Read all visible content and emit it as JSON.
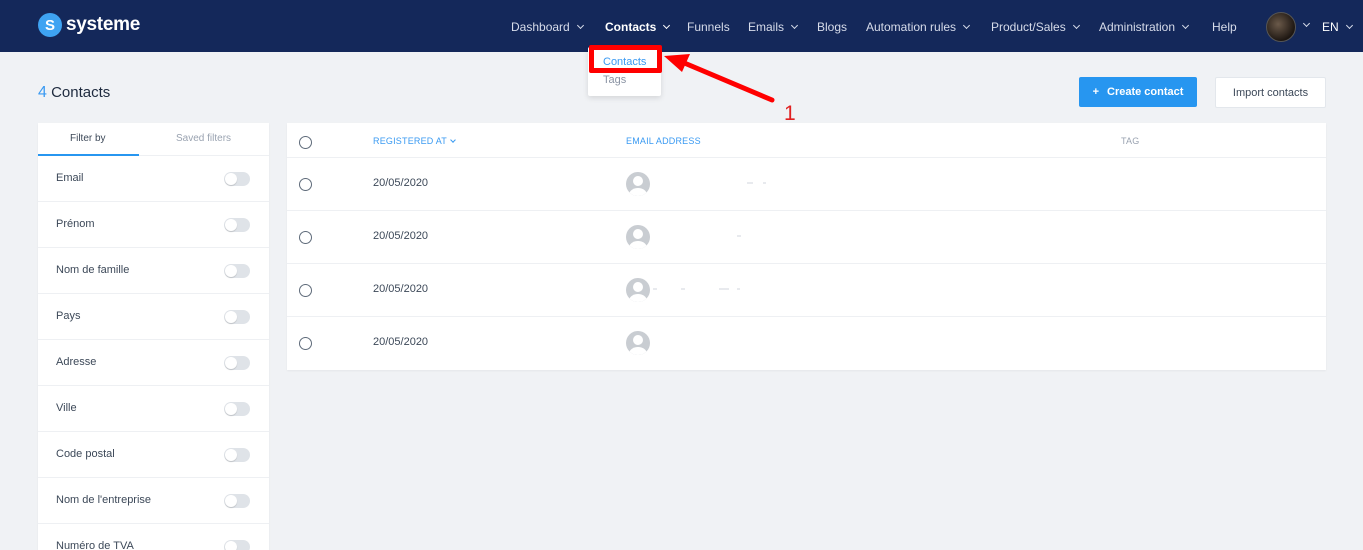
{
  "brand": {
    "name": "systeme",
    "mark": "S"
  },
  "nav": {
    "items": [
      {
        "label": "Dashboard",
        "has_menu": true
      },
      {
        "label": "Contacts",
        "has_menu": true,
        "active": true
      },
      {
        "label": "Funnels",
        "has_menu": false
      },
      {
        "label": "Emails",
        "has_menu": true
      },
      {
        "label": "Blogs",
        "has_menu": false
      },
      {
        "label": "Automation rules",
        "has_menu": true
      },
      {
        "label": "Product/Sales",
        "has_menu": true
      },
      {
        "label": "Administration",
        "has_menu": true
      },
      {
        "label": "Help",
        "has_menu": false
      }
    ],
    "language": "EN"
  },
  "dropdown": {
    "items": [
      "Contacts",
      "Tags"
    ]
  },
  "annotation": {
    "number": "1"
  },
  "header": {
    "count": "4",
    "title": "Contacts",
    "create_button": "Create contact",
    "create_icon": "+",
    "import_button": "Import contacts"
  },
  "filters": {
    "tabs": [
      "Filter by",
      "Saved filters"
    ],
    "items": [
      "Email",
      "Prénom",
      "Nom de famille",
      "Pays",
      "Adresse",
      "Ville",
      "Code postal",
      "Nom de l'entreprise",
      "Numéro de TVA"
    ]
  },
  "table": {
    "columns": {
      "registered": "REGISTERED AT",
      "email": "EMAIL ADDRESS",
      "tag": "TAG"
    },
    "rows": [
      {
        "registered": "20/05/2020"
      },
      {
        "registered": "20/05/2020"
      },
      {
        "registered": "20/05/2020"
      },
      {
        "registered": "20/05/2020"
      }
    ]
  },
  "colors": {
    "navbar": "#14285a",
    "accent": "#2796f0",
    "annotation": "#ff0000"
  }
}
